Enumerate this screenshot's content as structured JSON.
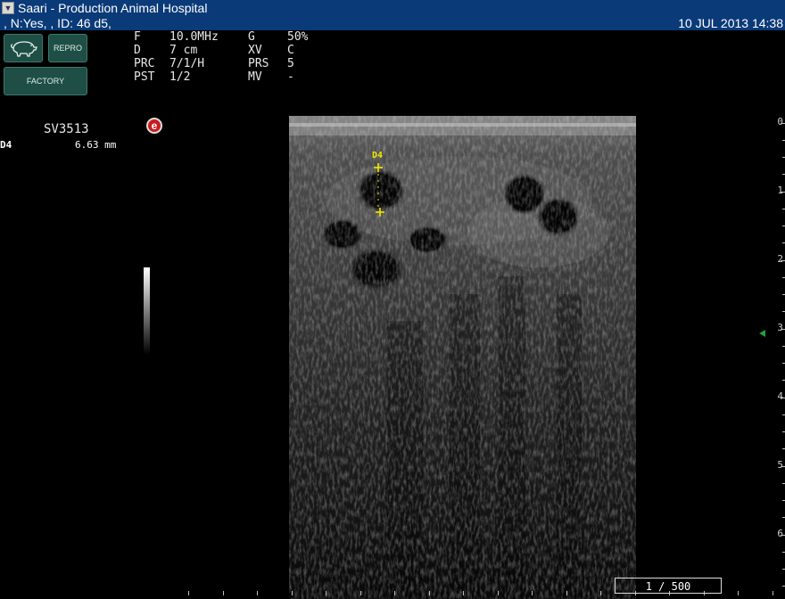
{
  "header": {
    "title": "Saari - Production Animal Hospital",
    "patient": ", N:Yes, , ID: 46 d5,",
    "datetime": "10 JUL 2013 14:38"
  },
  "buttons": {
    "repro": "REPRO",
    "factory": "FACTORY"
  },
  "params": [
    {
      "k1": "F",
      "v1": "10.0MHz",
      "k2": "G",
      "v2": "50%"
    },
    {
      "k1": "D",
      "v1": "7 cm",
      "k2": "XV",
      "v2": "C"
    },
    {
      "k1": "PRC",
      "v1": "7/1/H",
      "k2": "PRS",
      "v2": "5"
    },
    {
      "k1": "PST",
      "v1": "1/2",
      "k2": "MV",
      "v2": "-"
    }
  ],
  "probe": "SV3513",
  "measurement": {
    "label": "D4",
    "value": "6.63 mm"
  },
  "caliper_label": "D4",
  "depth_scale": [
    "0",
    "1",
    "2",
    "3",
    "4",
    "5",
    "6"
  ],
  "frame_counter": "1 / 500",
  "colors": {
    "title_bar": "#0a3a78",
    "button": "#1f4e46",
    "caliper": "#f3e600",
    "focus_marker": "#1fa23a"
  }
}
